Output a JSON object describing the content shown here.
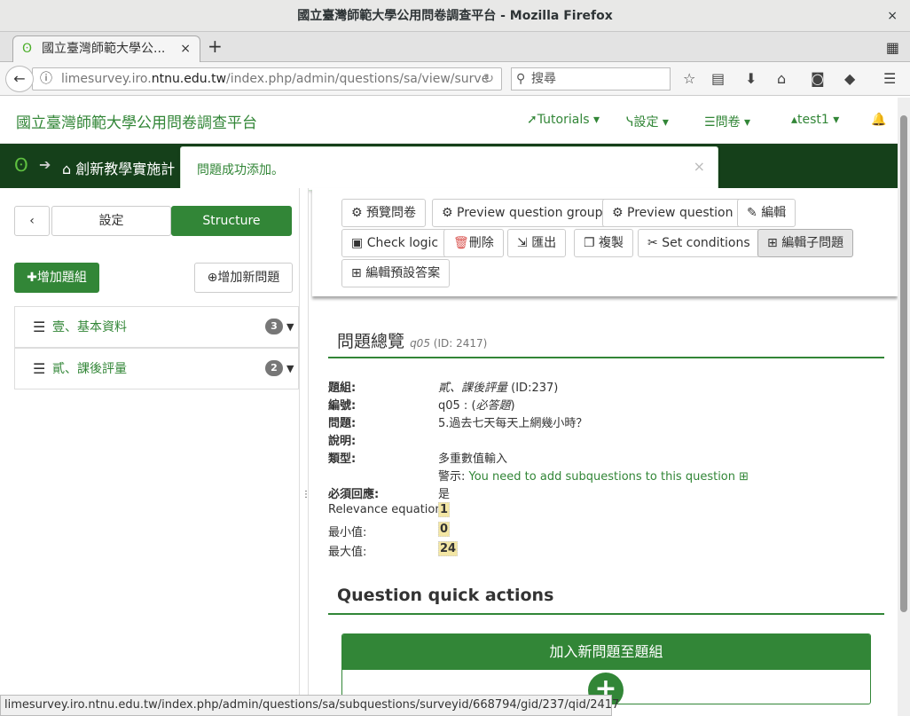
{
  "window": {
    "title": "國立臺灣師範大學公用問卷調查平台 - Mozilla Firefox",
    "close": "×"
  },
  "browser": {
    "tab_title": "國立臺灣師範大學公...",
    "tab_close": "×",
    "new_tab": "+",
    "url_pre": "limesurvey.iro.",
    "url_domain": "ntnu.edu.tw",
    "url_post": "/index.php/admin/questions/sa/view/surve",
    "search_placeholder": "搜尋"
  },
  "header": {
    "brand": "國立臺灣師範大學公用問卷調查平台",
    "nav": [
      {
        "label": "Tutorials ▾",
        "icon": "rocket-icon"
      },
      {
        "label": "設定 ▾",
        "icon": "wrench-icon"
      },
      {
        "label": "問卷  ▾",
        "icon": "list-icon"
      },
      {
        "label": "test1 ▾",
        "icon": "user-icon"
      }
    ]
  },
  "breadcrumb": {
    "survey": "創新教學實施計"
  },
  "alert": {
    "message": "問題成功添加。",
    "close": "×"
  },
  "sidebar": {
    "back": "‹",
    "tabs": [
      "設定",
      "Structure"
    ],
    "add_group": "增加題組",
    "add_question": "增加新問題",
    "groups": [
      {
        "name": "壹、基本資料",
        "count": "3"
      },
      {
        "name": "貳、課後評量",
        "count": "2"
      }
    ]
  },
  "toolbar": {
    "buttons": [
      "預覽問卷",
      "Preview question group",
      "Preview question",
      "編輯",
      "Check logic",
      "刪除",
      "匯出",
      "複製",
      "Set conditions",
      "編輯子問題",
      "編輯預設答案"
    ]
  },
  "overview": {
    "title": "問題總覽",
    "code": "q05",
    "id": "(ID: 2417)",
    "fields": [
      {
        "label": "題組:",
        "value": "貳、課後評量",
        "extra": " (ID:237)"
      },
      {
        "label": "編號:",
        "value": "q05 : (",
        "extra": "必答題",
        "end": ")"
      },
      {
        "label": "問題:",
        "value": "5.過去七天每天上網幾小時？"
      },
      {
        "label": "說明:",
        "value": ""
      },
      {
        "label": "類型:",
        "value": "多重數值輸入"
      }
    ],
    "warning_prefix": "警示: ",
    "warning": "You need to add subquestions to this question",
    "mandatory_label": "必須回應:",
    "mandatory_value": "是",
    "relevance_label": "Relevance equation:",
    "relevance_value": "1",
    "min_label": "最小值:",
    "min_value": "0",
    "max_label": "最大值:",
    "max_value": "24"
  },
  "quick_actions": {
    "title": "Question quick actions",
    "panel_title": "加入新問題至題組",
    "plus": "+"
  },
  "status_bar": "limesurvey.iro.ntnu.edu.tw/index.php/admin/questions/sa/subquestions/surveyid/668794/gid/237/qid/2417",
  "colors": {
    "accent": "#328637",
    "dark_bar": "#15401a"
  }
}
